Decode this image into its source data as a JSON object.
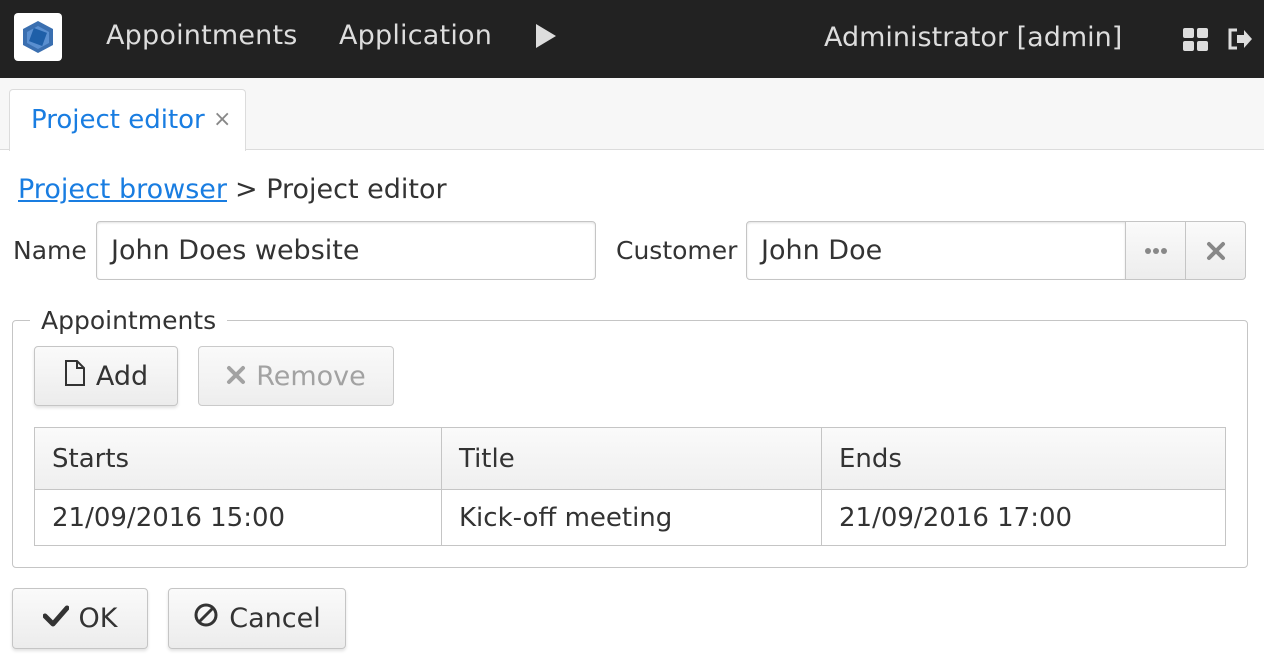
{
  "topbar": {
    "menu": [
      {
        "label": "Appointments"
      },
      {
        "label": "Application"
      }
    ],
    "user": "Administrator [admin]",
    "icons": {
      "logo": "app-logo-icon",
      "arrow": "play-arrow-icon",
      "apps": "apps-grid-icon",
      "logout": "logout-icon"
    }
  },
  "tabs": [
    {
      "label": "Project editor",
      "close": "×"
    }
  ],
  "breadcrumb": {
    "link": "Project browser",
    "current": "> Project editor"
  },
  "form": {
    "name_label": "Name",
    "name_value": "John Does website",
    "customer_label": "Customer",
    "customer_value": "John Doe"
  },
  "appointments": {
    "caption": "Appointments",
    "add_label": "Add",
    "remove_label": "Remove",
    "columns": [
      "Starts",
      "Title",
      "Ends"
    ],
    "rows": [
      [
        "21/09/2016 15:00",
        "Kick-off meeting",
        "21/09/2016 17:00"
      ]
    ]
  },
  "actions": {
    "ok_label": "OK",
    "cancel_label": "Cancel"
  },
  "colors": {
    "topbar": "#222222",
    "accent": "#197de1",
    "logo_blue": "#1e5fa8"
  }
}
